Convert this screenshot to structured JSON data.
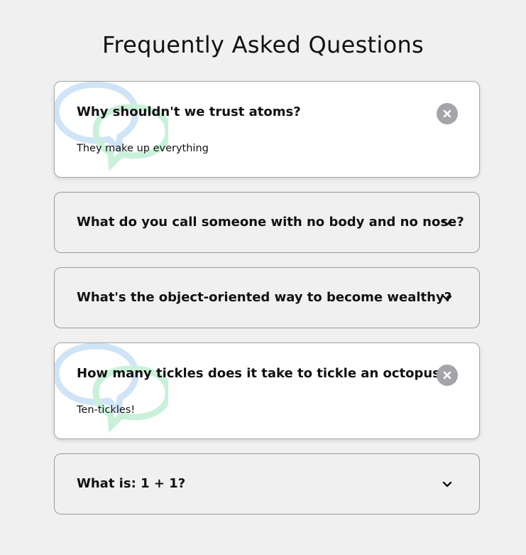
{
  "page_title": "Frequently Asked Questions",
  "colors": {
    "background": "#f0f0f0",
    "close_button": "#a3a5a8",
    "deco_bubble_blue": "#cfe4f6",
    "deco_bubble_green": "#c9f1d9"
  },
  "faqs": [
    {
      "question": "Why shouldn't we trust atoms?",
      "answer": "They make up everything",
      "expanded": true
    },
    {
      "question": "What do you call someone with no body and no nose?",
      "answer": "",
      "expanded": false
    },
    {
      "question": "What's the object-oriented way to become wealthy?",
      "answer": "",
      "expanded": false
    },
    {
      "question": "How many tickles does it take to tickle an octopus?",
      "answer": "Ten-tickles!",
      "expanded": true
    },
    {
      "question": "What is: 1 + 1?",
      "answer": "",
      "expanded": false
    }
  ],
  "icons": {
    "expanded_toggle": "close-icon",
    "collapsed_toggle": "chevron-down-icon",
    "decoration": "speech-bubbles-icon"
  }
}
